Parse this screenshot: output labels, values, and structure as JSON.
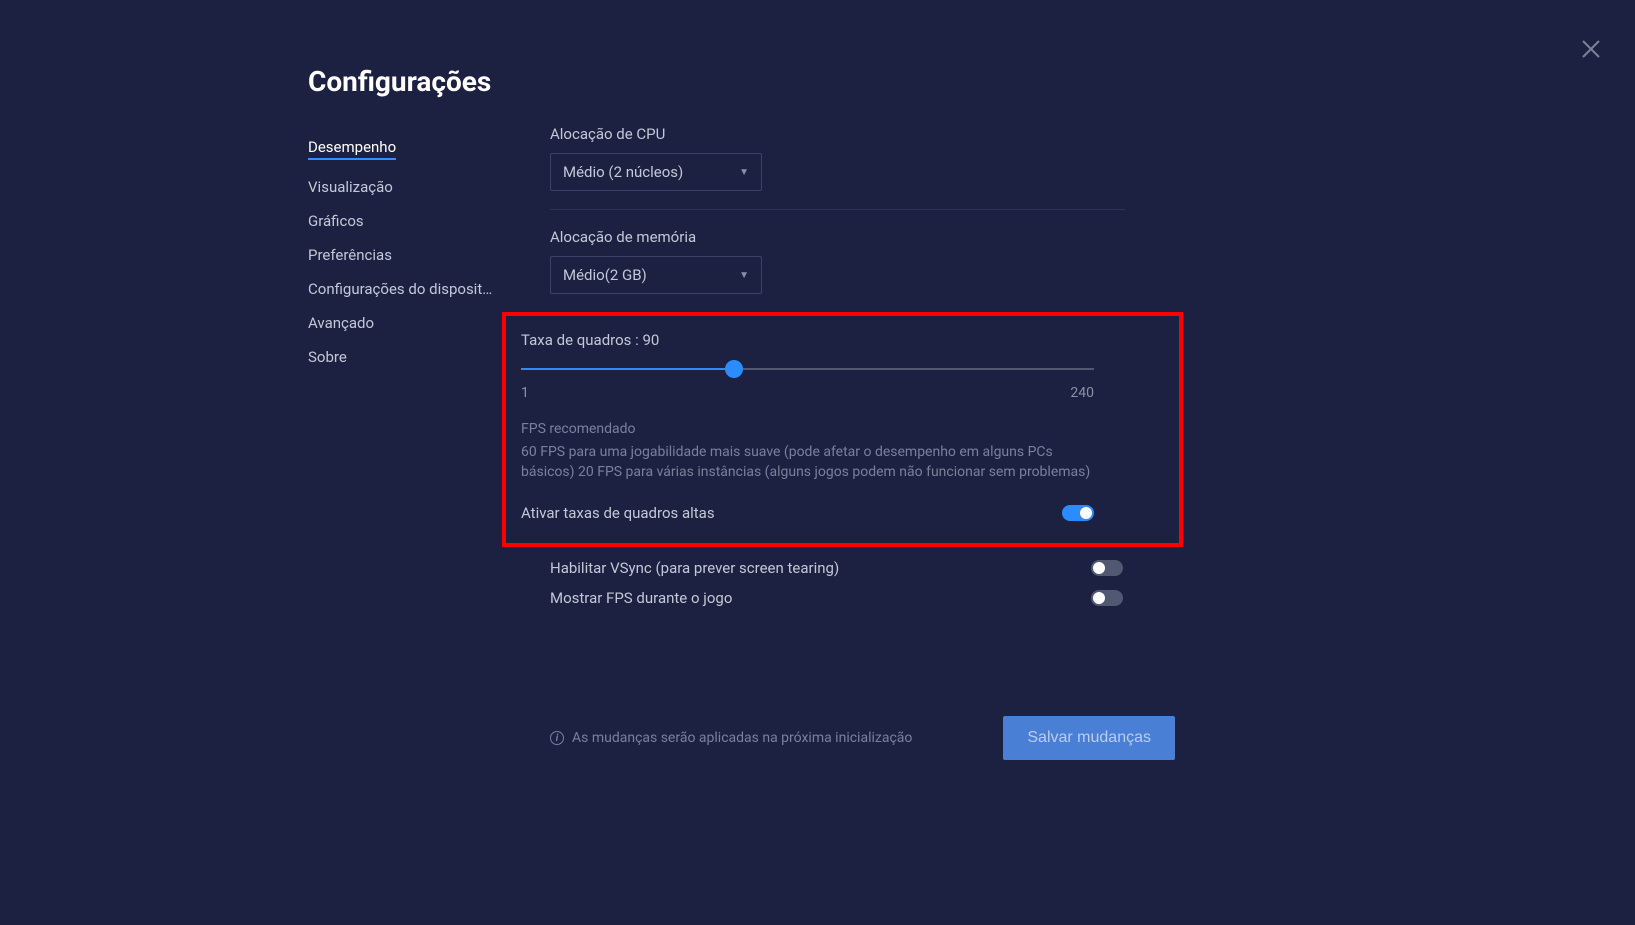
{
  "title": "Configurações",
  "sidebar": {
    "items": [
      {
        "label": "Desempenho",
        "active": true
      },
      {
        "label": "Visualização"
      },
      {
        "label": "Gráficos"
      },
      {
        "label": "Preferências"
      },
      {
        "label": "Configurações do disposit…"
      },
      {
        "label": "Avançado"
      },
      {
        "label": "Sobre"
      }
    ]
  },
  "content": {
    "cpu_label": "Alocação de CPU",
    "cpu_value": "Médio (2 núcleos)",
    "memory_label": "Alocação de memória",
    "memory_value": "Médio(2 GB)",
    "framerate": {
      "label": "Taxa de quadros : 90",
      "min": "1",
      "max": "240",
      "value": 90,
      "fill_percent": 37.2
    },
    "fps_recommended_title": "FPS recomendado",
    "fps_recommended_desc": "60 FPS para uma jogabilidade mais suave (pode afetar o desempenho em alguns PCs básicos) 20 FPS para várias instâncias (alguns jogos podem não funcionar sem problemas)",
    "toggles": {
      "high_framerate": {
        "label": "Ativar taxas de quadros altas",
        "on": true
      },
      "vsync": {
        "label": "Habilitar VSync (para prever screen tearing)",
        "on": false
      },
      "show_fps": {
        "label": "Mostrar FPS durante o jogo",
        "on": false
      }
    }
  },
  "footer": {
    "info": "As mudanças serão aplicadas na próxima inicialização",
    "save": "Salvar mudanças"
  }
}
